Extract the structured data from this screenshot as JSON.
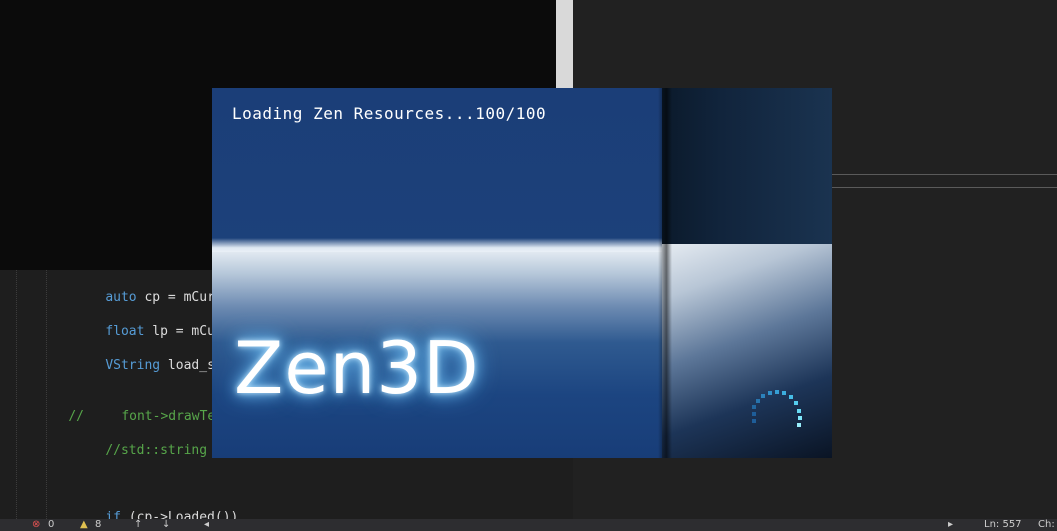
{
  "splash": {
    "loading_text": "Loading Zen Resources...100/100",
    "logo_text": "Zen3D"
  },
  "editor": {
    "lines": [
      {
        "keyword": "auto",
        "text": " cp = mCurrent"
      },
      {
        "keyword": "float",
        "text": " lp = mCurren"
      },
      {
        "keyword": "VString",
        "text": " load_strin"
      },
      {
        "prefix": "//",
        "comment": "font->drawText(l"
      },
      {
        "comment_full": "//std::string load"
      },
      {
        "keyword": "if",
        "text": " (cp->Loaded())"
      }
    ]
  },
  "statusbar": {
    "errors": "0",
    "warnings": "8",
    "line_label": "Ln: 557",
    "col_label": "Ch:"
  },
  "colors": {
    "keyword": "#569cd6",
    "comment": "#57a64a",
    "splash_blue": "#1a3f78",
    "logo_glow": "#7fcfff"
  }
}
